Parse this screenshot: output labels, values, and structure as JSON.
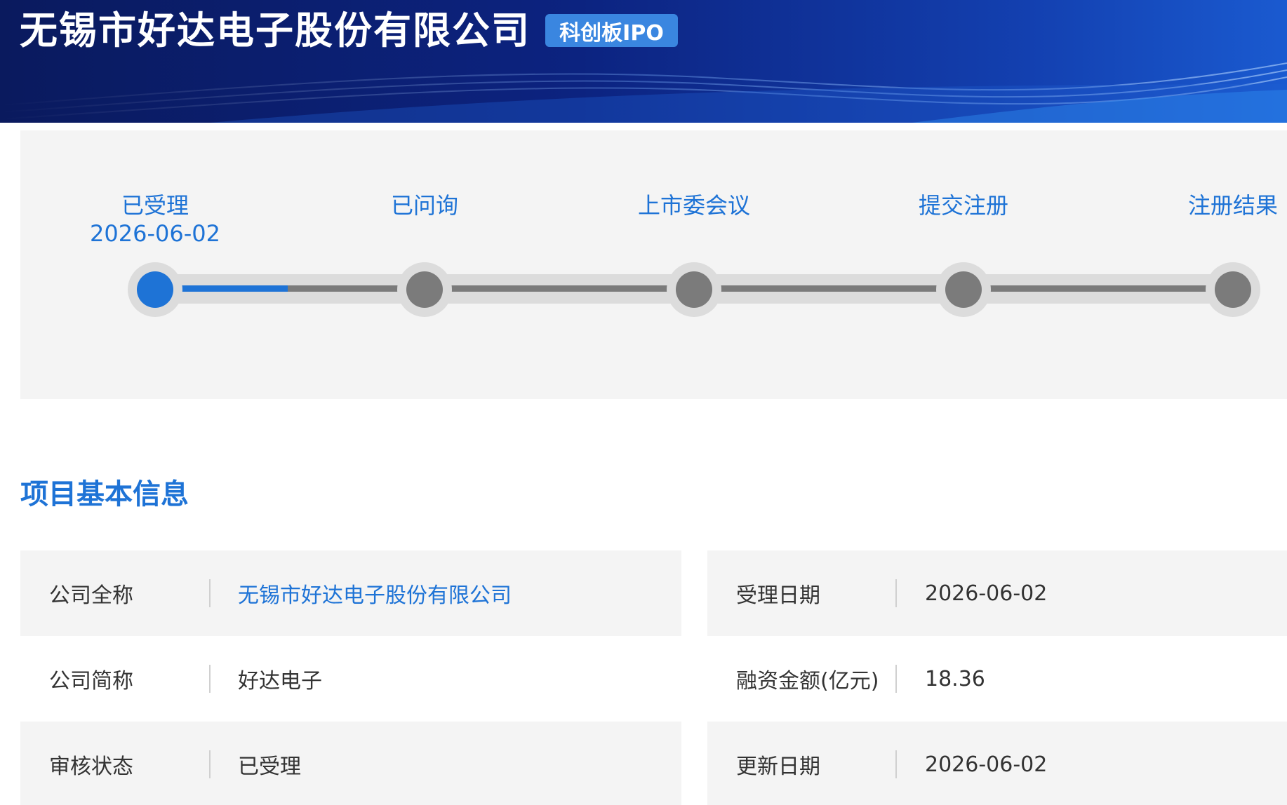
{
  "header": {
    "company_title": "无锡市好达电子股份有限公司",
    "board_badge": "科创板IPO"
  },
  "progress": {
    "steps": [
      {
        "label": "已受理",
        "date": "2026-06-02",
        "active": true
      },
      {
        "label": "已问询",
        "date": "",
        "active": false
      },
      {
        "label": "上市委会议",
        "date": "",
        "active": false
      },
      {
        "label": "提交注册",
        "date": "",
        "active": false
      },
      {
        "label": "注册结果",
        "date": "",
        "active": false
      }
    ],
    "completion_fraction": 0.125
  },
  "section": {
    "title": "项目基本信息"
  },
  "info": {
    "left": [
      {
        "label": "公司全称",
        "value": "无锡市好达电子股份有限公司"
      },
      {
        "label": "公司简称",
        "value": "好达电子"
      },
      {
        "label": "审核状态",
        "value": "已受理"
      }
    ],
    "right": [
      {
        "label": "受理日期",
        "value": "2026-06-02"
      },
      {
        "label": "融资金额(亿元)",
        "value": "18.36"
      },
      {
        "label": "更新日期",
        "value": "2026-06-02"
      }
    ]
  },
  "colors": {
    "accent": "#1e73d6",
    "banner_dark": "#0a1a5e",
    "badge": "#3a86e0",
    "inactive_node": "#7b7b7b"
  }
}
